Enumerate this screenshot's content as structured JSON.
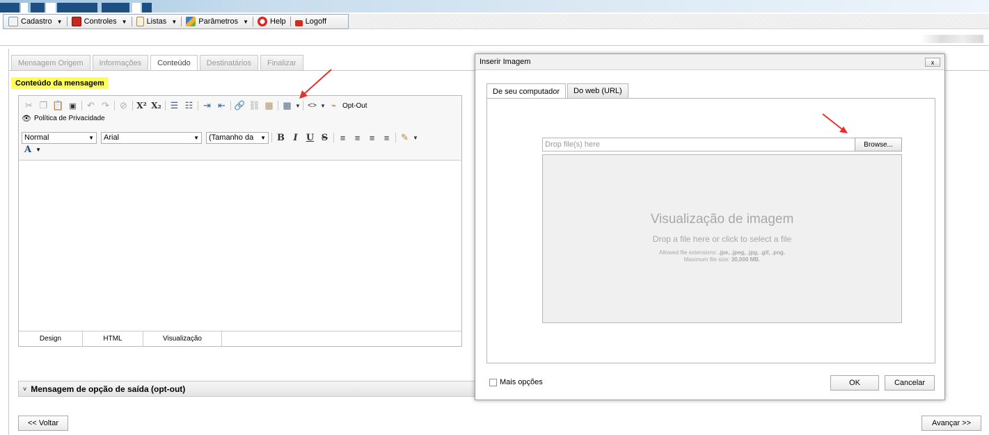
{
  "menu": {
    "items": [
      {
        "label": "Cadastro",
        "icon": "address-book-icon",
        "dropdown": true
      },
      {
        "label": "Controles",
        "icon": "controls-icon",
        "dropdown": true
      },
      {
        "label": "Listas",
        "icon": "clipboard-icon",
        "dropdown": true
      },
      {
        "label": "Parâmetros",
        "icon": "chart-icon",
        "dropdown": true
      },
      {
        "label": "Help",
        "icon": "lifebuoy-icon",
        "dropdown": false
      },
      {
        "label": "Logoff",
        "icon": "padlock-icon",
        "dropdown": false
      }
    ]
  },
  "wizard": {
    "tabs": [
      "Mensagem Origem",
      "Informações",
      "Conteúdo",
      "Destinatários",
      "Finalizar"
    ],
    "active_tab": "Conteúdo",
    "section_title": "Conteúdo da mensagem"
  },
  "editor": {
    "optout_label": "Opt-Out",
    "privacy_label": "Política de Privacidade",
    "format_value": "Normal",
    "font_value": "Arial",
    "size_value": "(Tamanho da",
    "superscript_label": "X²",
    "subscript_label": "X₂",
    "bold_label": "B",
    "italic_label": "I",
    "underline_label": "U",
    "strike_label": "S",
    "font_color_label": "A",
    "mode_tabs": [
      "Design",
      "HTML",
      "Visualização"
    ]
  },
  "optout_section": {
    "title": "Mensagem de opção de saída (opt-out)"
  },
  "nav": {
    "back": "<< Voltar",
    "next": "Avançar >>"
  },
  "dialog": {
    "title": "Inserir Imagem",
    "close": "x",
    "tabs": [
      "De seu computador",
      "Do web (URL)"
    ],
    "active_tab": "De seu computador",
    "drop_placeholder": "Drop file(s) here",
    "browse": "Browse...",
    "preview_title": "Visualização de imagem",
    "preview_subtitle": "Drop a file here or click to select a file",
    "allowed_prefix": "Allowed file extensions: ",
    "allowed_value": ".jpe, .jpeg, .jpg, .gif, .png.",
    "max_prefix": "Maximum file size: ",
    "max_value": "30,000 MB.",
    "more_options": "Mais opções",
    "ok": "OK",
    "cancel": "Cancelar"
  },
  "colors": {
    "highlight": "#ffff55",
    "arrow": "#e8302a",
    "brand_header": "#1e4f82"
  }
}
